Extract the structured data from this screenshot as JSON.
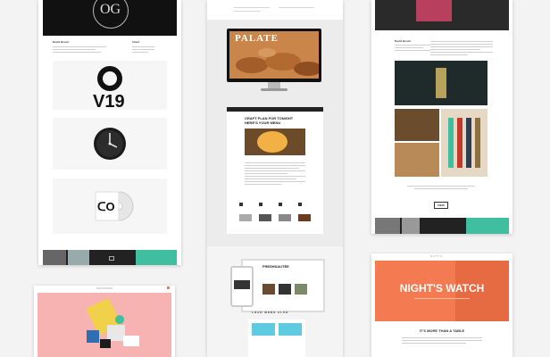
{
  "col1": {
    "logo_text": "OG",
    "author_label": "David Brown",
    "client_label": "Client",
    "hero_letters": "O",
    "hero_numbers": "V19",
    "brand_letters": "O"
  },
  "col2": {
    "monitor_headline": "PALATE",
    "article_title": "CRAFT PLAN FOR TONIGHT\nHERE'S YOUR MENU",
    "cta_label": "LOAD MORE ALSO",
    "app_title": "FRESHSAUTÉE"
  },
  "col3": {
    "author_label": "David Brown",
    "button_label": "VIEW"
  },
  "col4": {
    "hero_title": "NIGHT'S WATCH",
    "subtitle": "IT'S MORE THAN A TABLE",
    "nav_label": "NOTIC"
  },
  "colors": {
    "pink": "#f6b3b1",
    "orange": "#f47a52",
    "teal": "#3fbfa0",
    "dark": "#1c1c1c"
  }
}
